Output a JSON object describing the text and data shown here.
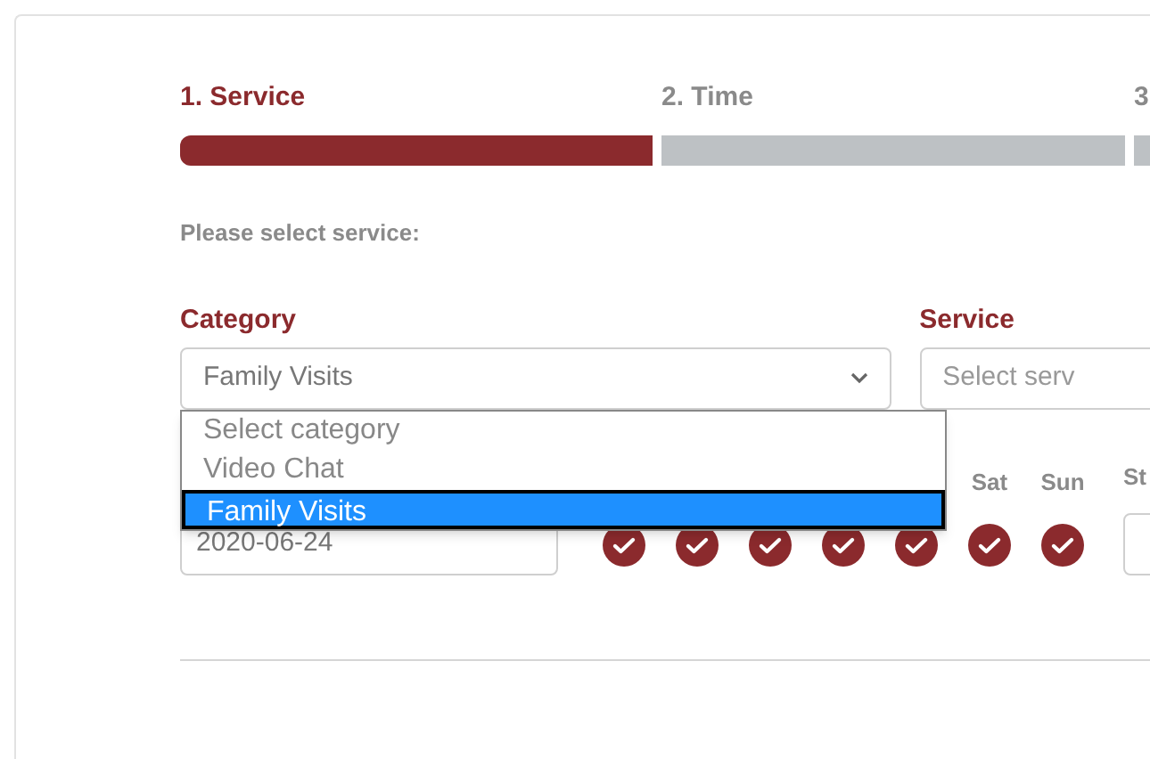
{
  "steps": [
    {
      "label": "1. Service",
      "selected": true
    },
    {
      "label": "2. Time",
      "selected": false
    },
    {
      "label": "3",
      "selected": false
    }
  ],
  "prompt": "Please select service:",
  "category": {
    "label": "Category",
    "value": "Family Visits",
    "expanded": true,
    "options": [
      {
        "label": "Select category",
        "selected": false
      },
      {
        "label": "Video Chat",
        "selected": false
      },
      {
        "label": "Family Visits",
        "selected": true
      }
    ]
  },
  "service": {
    "label": "Service",
    "placeholder": "Select serv"
  },
  "date": {
    "value": "2020-06-24"
  },
  "days": [
    {
      "checked": true
    },
    {
      "checked": true
    },
    {
      "checked": true
    },
    {
      "checked": true
    },
    {
      "checked": true
    },
    {
      "label": "Sat",
      "checked": true
    },
    {
      "label": "Sun",
      "checked": true
    }
  ],
  "column_3": {
    "label": "St"
  }
}
